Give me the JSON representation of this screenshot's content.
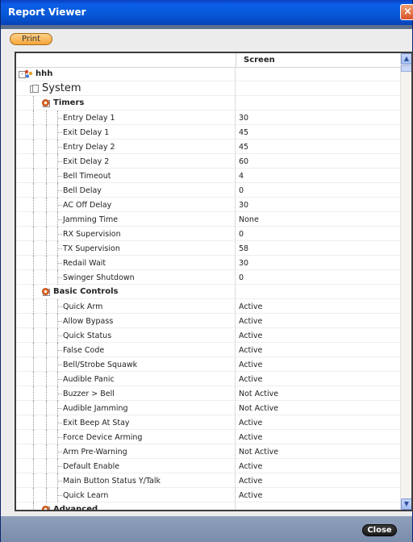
{
  "window": {
    "title": "Report Viewer",
    "close_icon": "×"
  },
  "toolbar": {
    "print_label": "Print"
  },
  "table": {
    "column_header": "Screen",
    "rows": [
      {
        "label": "hhh",
        "value": "",
        "level": 0,
        "type": "root"
      },
      {
        "label": "System",
        "value": "",
        "level": 1,
        "type": "doc"
      },
      {
        "label": "Timers",
        "value": "",
        "level": 2,
        "type": "gear"
      },
      {
        "label": "Entry Delay 1",
        "value": "30",
        "level": 3
      },
      {
        "label": "Exit Delay 1",
        "value": "45",
        "level": 3
      },
      {
        "label": "Entry Delay 2",
        "value": "45",
        "level": 3
      },
      {
        "label": "Exit Delay 2",
        "value": "60",
        "level": 3
      },
      {
        "label": "Bell Timeout",
        "value": "4",
        "level": 3
      },
      {
        "label": "Bell Delay",
        "value": "0",
        "level": 3
      },
      {
        "label": "AC Off Delay",
        "value": "30",
        "level": 3
      },
      {
        "label": "Jamming Time",
        "value": "None",
        "level": 3
      },
      {
        "label": "RX Supervision",
        "value": "0",
        "level": 3
      },
      {
        "label": "TX Supervision",
        "value": "58",
        "level": 3
      },
      {
        "label": "Redail Wait",
        "value": "30",
        "level": 3
      },
      {
        "label": "Swinger Shutdown",
        "value": "0",
        "level": 3
      },
      {
        "label": "Basic Controls",
        "value": "",
        "level": 2,
        "type": "gear"
      },
      {
        "label": "Quick Arm",
        "value": "Active",
        "level": 3
      },
      {
        "label": "Allow Bypass",
        "value": "Active",
        "level": 3
      },
      {
        "label": "Quick Status",
        "value": "Active",
        "level": 3
      },
      {
        "label": "False Code",
        "value": "Active",
        "level": 3
      },
      {
        "label": "Bell/Strobe Squawk",
        "value": "Active",
        "level": 3
      },
      {
        "label": "Audible Panic",
        "value": "Active",
        "level": 3
      },
      {
        "label": "Buzzer > Bell",
        "value": "Not Active",
        "level": 3
      },
      {
        "label": "Audible Jamming",
        "value": "Not Active",
        "level": 3
      },
      {
        "label": "Exit Beep At Stay",
        "value": "Active",
        "level": 3
      },
      {
        "label": "Force Device Arming",
        "value": "Active",
        "level": 3
      },
      {
        "label": "Arm Pre-Warning",
        "value": "Not Active",
        "level": 3
      },
      {
        "label": "Default Enable",
        "value": "Active",
        "level": 3
      },
      {
        "label": "Main Button Status Y/Talk",
        "value": "Active",
        "level": 3
      },
      {
        "label": "Quick Learn",
        "value": "Active",
        "level": 3
      },
      {
        "label": "Advanced",
        "value": "",
        "level": 2,
        "type": "gear"
      }
    ]
  },
  "footer": {
    "close_label": "Close"
  },
  "icons": {
    "expander": "-",
    "scroll_up": "▲",
    "scroll_down": "▼"
  }
}
